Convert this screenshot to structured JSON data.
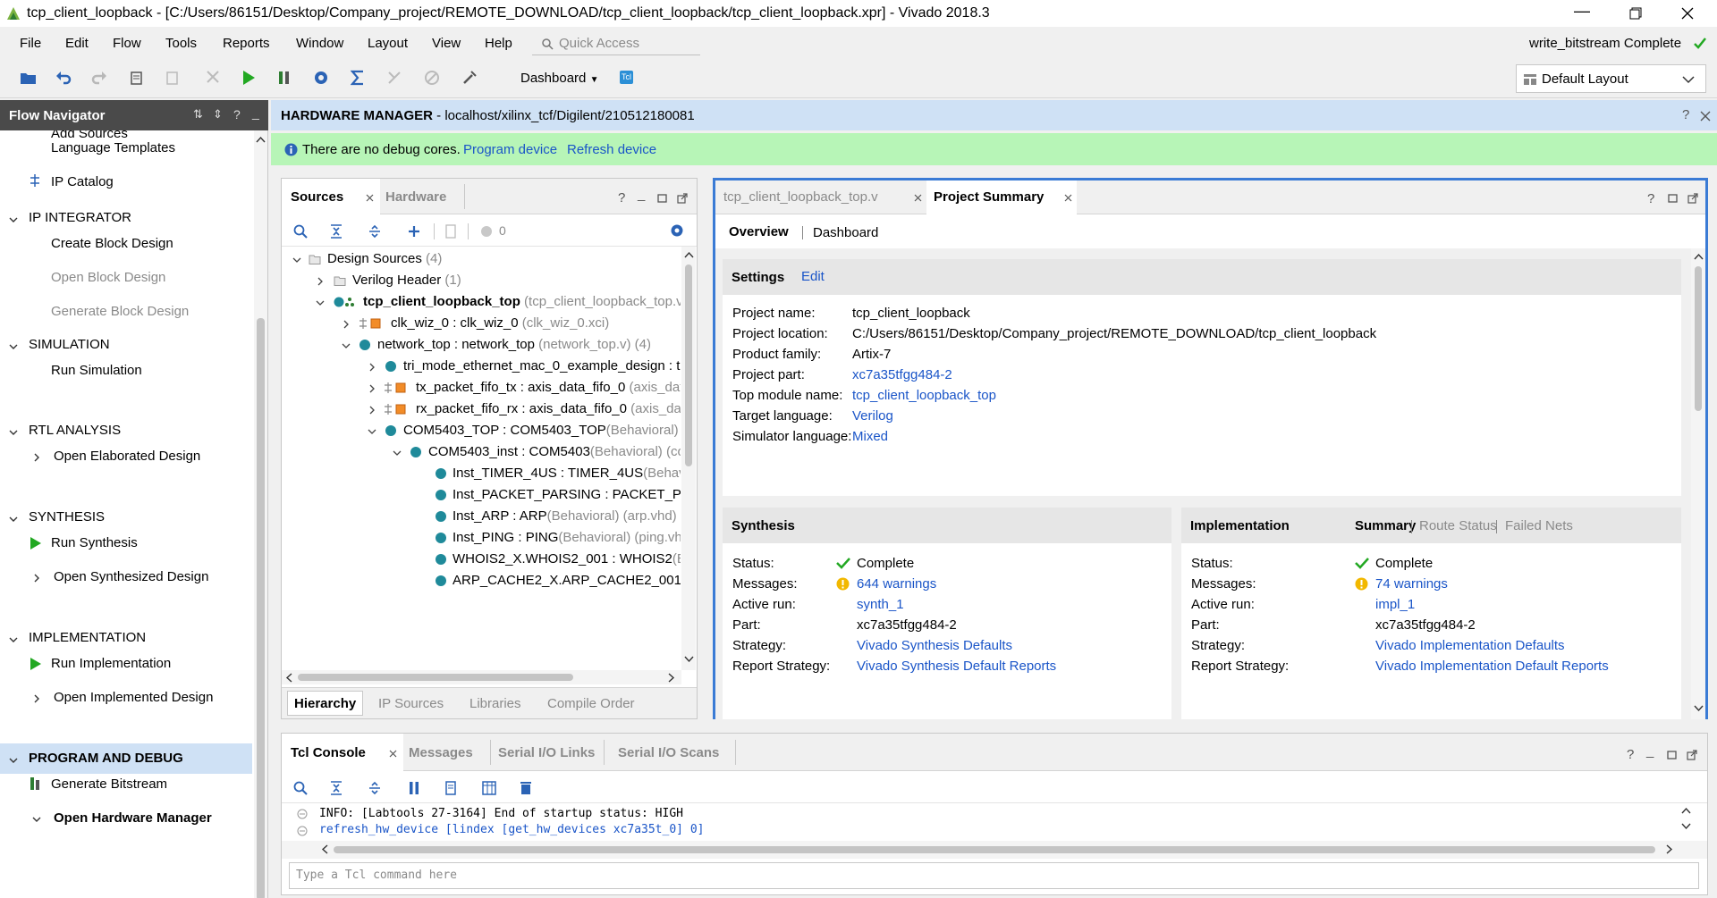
{
  "window": {
    "title": "tcp_client_loopback - [C:/Users/86151/Desktop/Company_project/REMOTE_DOWNLOAD/tcp_client_loopback/tcp_client_loopback.xpr] - Vivado 2018.3"
  },
  "menu": [
    "File",
    "Edit",
    "Flow",
    "Tools",
    "Reports",
    "Window",
    "Layout",
    "View",
    "Help"
  ],
  "quick_access": {
    "placeholder": "Quick Access"
  },
  "status": {
    "text": "write_bitstream Complete"
  },
  "toolbar": {
    "dashboard_label": "Dashboard",
    "layout_label": "Default Layout"
  },
  "flow_nav": {
    "title": "Flow Navigator",
    "partial_item": "Add Sources",
    "items_top": [
      "Language Templates",
      "IP Catalog"
    ],
    "ip_integrator": {
      "title": "IP INTEGRATOR",
      "items": [
        "Create Block Design",
        "Open Block Design",
        "Generate Block Design"
      ]
    },
    "simulation": {
      "title": "SIMULATION",
      "items": [
        "Run Simulation"
      ]
    },
    "rtl": {
      "title": "RTL ANALYSIS",
      "items": [
        "Open Elaborated Design"
      ]
    },
    "synthesis": {
      "title": "SYNTHESIS",
      "items": [
        "Run Synthesis",
        "Open Synthesized Design"
      ]
    },
    "implementation": {
      "title": "IMPLEMENTATION",
      "items": [
        "Run Implementation",
        "Open Implemented Design"
      ]
    },
    "program": {
      "title": "PROGRAM AND DEBUG",
      "items": [
        "Generate Bitstream",
        "Open Hardware Manager"
      ]
    }
  },
  "hw_manager": {
    "title": "HARDWARE MANAGER",
    "path": " - localhost/xilinx_tcf/Digilent/210512180081",
    "debug_msg": "There are no debug cores.",
    "program_link": "Program device",
    "refresh_link": "Refresh device"
  },
  "sources": {
    "tabs": [
      "Sources",
      "Hardware"
    ],
    "count": "0",
    "bottom_tabs": [
      "Hierarchy",
      "IP Sources",
      "Libraries",
      "Compile Order"
    ],
    "tree": [
      {
        "name": "Design Sources",
        "suffix": " (4)"
      },
      {
        "name": "Verilog Header",
        "suffix": " (1)"
      },
      {
        "name": "tcp_client_loopback_top",
        "suffix": " (tcp_client_loopback_top.v)"
      },
      {
        "name": "clk_wiz_0 : clk_wiz_0",
        "suffix": " (clk_wiz_0.xci)"
      },
      {
        "name": "network_top : network_top",
        "suffix": " (network_top.v) (4)"
      },
      {
        "name": "tri_mode_ethernet_mac_0_example_design : tri",
        "suffix": ""
      },
      {
        "name": "tx_packet_fifo_tx : axis_data_fifo_0",
        "suffix": " (axis_data"
      },
      {
        "name": "rx_packet_fifo_rx : axis_data_fifo_0",
        "suffix": " (axis_data"
      },
      {
        "name": "COM5403_TOP : COM5403_TOP",
        "suffix": "(Behavioral) ("
      },
      {
        "name": "COM5403_inst : COM5403",
        "suffix": "(Behavioral) (co"
      },
      {
        "name": "Inst_TIMER_4US : TIMER_4US",
        "suffix": "(Behavi"
      },
      {
        "name": "Inst_PACKET_PARSING : PACKET_P",
        "suffix": ""
      },
      {
        "name": "Inst_ARP : ARP",
        "suffix": "(Behavioral) (arp.vhd)"
      },
      {
        "name": "Inst_PING : PING",
        "suffix": "(Behavioral) (ping.vhd"
      },
      {
        "name": "WHOIS2_X.WHOIS2_001 : WHOIS2",
        "suffix": "(B"
      },
      {
        "name": "ARP_CACHE2_X.ARP_CACHE2_001 :",
        "suffix": ""
      }
    ]
  },
  "editor": {
    "tabs": [
      "tcp_client_loopback_top.v",
      "Project Summary"
    ],
    "subtabs": [
      "Overview",
      "Dashboard"
    ],
    "settings": {
      "title": "Settings",
      "edit": "Edit",
      "rows": [
        {
          "k": "Project name:",
          "v": "tcp_client_loopback"
        },
        {
          "k": "Project location:",
          "v": "C:/Users/86151/Desktop/Company_project/REMOTE_DOWNLOAD/tcp_client_loopback"
        },
        {
          "k": "Product family:",
          "v": "Artix-7"
        },
        {
          "k": "Project part:",
          "v": "xc7a35tfgg484-2"
        },
        {
          "k": "Top module name:",
          "v": "tcp_client_loopback_top"
        },
        {
          "k": "Target language:",
          "v": "Verilog"
        },
        {
          "k": "Simulator language:",
          "v": "Mixed"
        }
      ]
    },
    "synthesis": {
      "title": "Synthesis",
      "rows": [
        {
          "k": "Status:",
          "v": "Complete"
        },
        {
          "k": "Messages:",
          "v": "644 warnings"
        },
        {
          "k": "Active run:",
          "v": "synth_1"
        },
        {
          "k": "Part:",
          "v": "xc7a35tfgg484-2"
        },
        {
          "k": "Strategy:",
          "v": "Vivado Synthesis Defaults"
        },
        {
          "k": "Report Strategy:",
          "v": "Vivado Synthesis Default Reports"
        }
      ]
    },
    "implementation": {
      "title": "Implementation",
      "tabs": [
        "Summary",
        "Route Status",
        "Failed Nets"
      ],
      "rows": [
        {
          "k": "Status:",
          "v": "Complete"
        },
        {
          "k": "Messages:",
          "v": "74 warnings"
        },
        {
          "k": "Active run:",
          "v": "impl_1"
        },
        {
          "k": "Part:",
          "v": "xc7a35tfgg484-2"
        },
        {
          "k": "Strategy:",
          "v": "Vivado Implementation Defaults"
        },
        {
          "k": "Report Strategy:",
          "v": "Vivado Implementation Default Reports"
        }
      ]
    }
  },
  "console": {
    "tabs": [
      "Tcl Console",
      "Messages",
      "Serial I/O Links",
      "Serial I/O Scans"
    ],
    "line1": "INFO: [Labtools 27-3164] End of startup status: HIGH",
    "line2": "refresh_hw_device [lindex [get_hw_devices xc7a35t_0] 0]",
    "placeholder": "Type a Tcl command here"
  },
  "colors": {
    "link": "#1a55c8",
    "hw_bar": "#cfe1f5",
    "debug_bar": "#b7f5b7",
    "accent_green": "#22a822",
    "warning": "#f2b800",
    "nav_header": "#4a4a4a",
    "selected": "#cfe1f5"
  }
}
